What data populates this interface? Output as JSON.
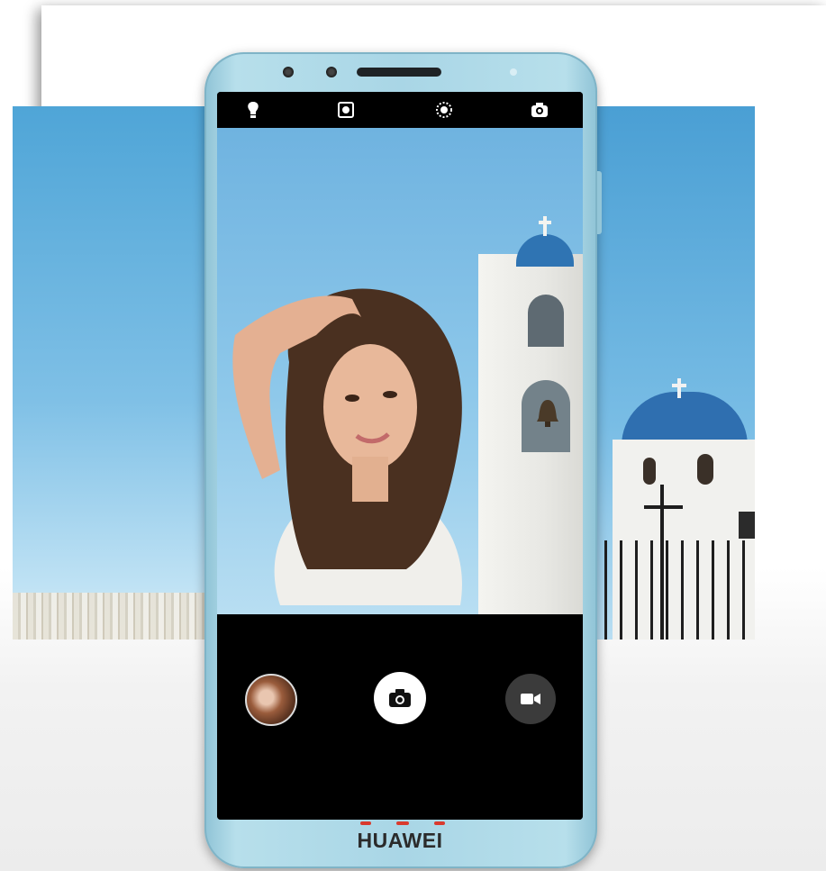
{
  "brand": {
    "name": "HUAWEI"
  },
  "camera": {
    "top_bar_icons": [
      "flash-auto-icon",
      "aperture-mode-icon",
      "live-photo-icon",
      "switch-camera-icon"
    ],
    "bottom_controls": [
      "gallery-thumbnail",
      "shutter-button",
      "video-mode-button"
    ]
  },
  "colors": {
    "phone_body": "#a9d6e6",
    "sky": "#6fb3e0",
    "dome": "#2f74b3"
  }
}
